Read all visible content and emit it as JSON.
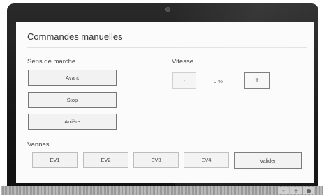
{
  "window": {
    "title": "Commandes manuelles",
    "controls": {
      "minimize": "–",
      "maximize": "+",
      "close": "●"
    }
  },
  "direction": {
    "label": "Sens de marche",
    "buttons": [
      "Avant",
      "Stop",
      "Arrière"
    ]
  },
  "speed": {
    "label": "Vitesse",
    "minus": "-",
    "value": "0 %",
    "plus": "+"
  },
  "valves": {
    "label": "Vannes",
    "buttons": [
      "EV1",
      "EV2",
      "EV3",
      "EV4"
    ],
    "validate": "Valider"
  }
}
